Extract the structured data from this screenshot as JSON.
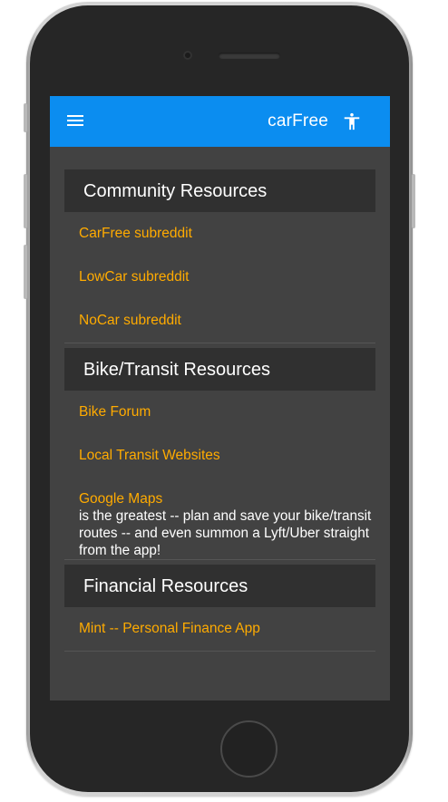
{
  "app_bar": {
    "title": "carFree",
    "menu_icon": "hamburger-menu-icon",
    "accessibility_icon": "accessibility-icon",
    "color": "#0b8df0"
  },
  "accent_color": "#ffab00",
  "sections": [
    {
      "title": "Community Resources",
      "links": [
        "CarFree subreddit",
        "LowCar subreddit",
        "NoCar subreddit"
      ]
    },
    {
      "title": "Bike/Transit Resources",
      "links": [
        "Bike Forum",
        "Local Transit Websites",
        "Google Maps"
      ],
      "note": "is the greatest -- plan and save your bike/transit routes -- and even summon a Lyft/Uber straight from the app!"
    },
    {
      "title": "Financial Resources",
      "links": [
        "Mint -- Personal Finance App"
      ]
    }
  ]
}
